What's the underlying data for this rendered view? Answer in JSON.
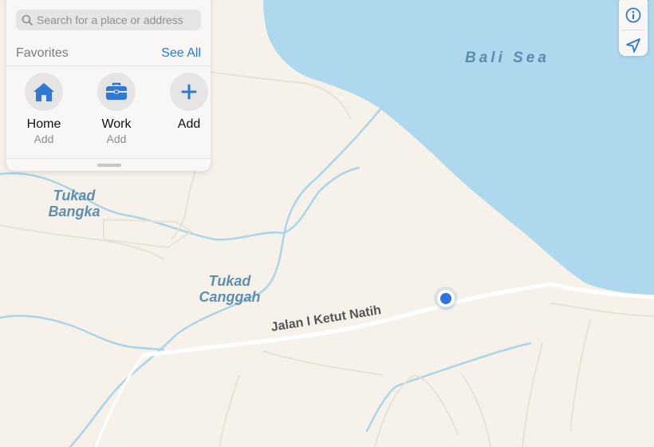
{
  "search": {
    "placeholder": "Search for a place or address"
  },
  "favorites": {
    "heading": "Favorites",
    "see_all_label": "See All",
    "items": [
      {
        "title": "Home",
        "subtitle": "Add",
        "icon": "house-icon"
      },
      {
        "title": "Work",
        "subtitle": "Add",
        "icon": "briefcase-icon"
      },
      {
        "title": "Add",
        "subtitle": "",
        "icon": "plus-icon"
      }
    ]
  },
  "map": {
    "sea_label": "Bali Sea",
    "river_labels": [
      "Tukad\nBangka",
      "Tukad\nCanggah"
    ],
    "road_label": "Jalan I Ketut Natih"
  },
  "controls": {
    "info_icon": "info-icon",
    "location_icon": "location-arrow-icon"
  },
  "colors": {
    "land": "#f6f2ea",
    "water": "#aed8ee",
    "river": "#a9d4ea",
    "accent": "#2f78d3",
    "location_dot": "#2f73e0"
  }
}
